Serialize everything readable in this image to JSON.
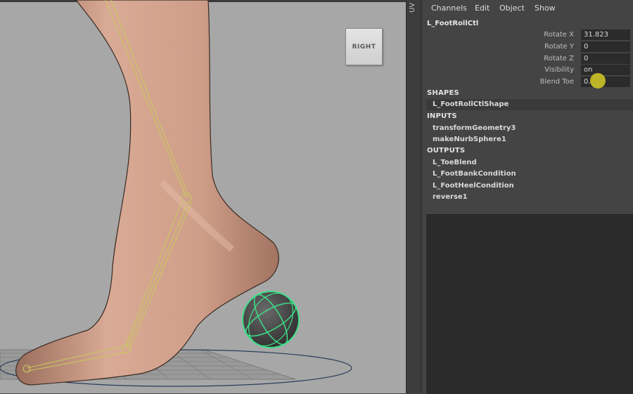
{
  "viewport": {
    "viewcube_label": "RIGHT",
    "bg_color": "#a7a7a7"
  },
  "side_tab": {
    "label": "UV"
  },
  "menubar": {
    "items": [
      "Channels",
      "Edit",
      "Object",
      "Show"
    ]
  },
  "node": {
    "title": "L_FootRollCtl"
  },
  "attributes": [
    {
      "label": "Rotate X",
      "value": "31.823"
    },
    {
      "label": "Rotate Y",
      "value": "0"
    },
    {
      "label": "Rotate Z",
      "value": "0"
    },
    {
      "label": "Visibility",
      "value": "on"
    },
    {
      "label": "Blend Toe",
      "value": "0."
    }
  ],
  "shapes": {
    "header": "SHAPES",
    "items": [
      "L_FootRollCtlShape"
    ]
  },
  "inputs": {
    "header": "INPUTS",
    "items": [
      "transformGeometry3",
      "makeNurbSphere1"
    ]
  },
  "outputs": {
    "header": "OUTPUTS",
    "items": [
      "L_ToeBlend",
      "L_FootBankCondition",
      "L_FootHeelCondition",
      "reverse1"
    ]
  },
  "colors": {
    "panel_bg": "#444444",
    "field_bg": "#2b2b2b",
    "joint_color": "#c8c860",
    "controller_color": "#3fe08a",
    "cursor_highlight": "#d7cd28"
  }
}
